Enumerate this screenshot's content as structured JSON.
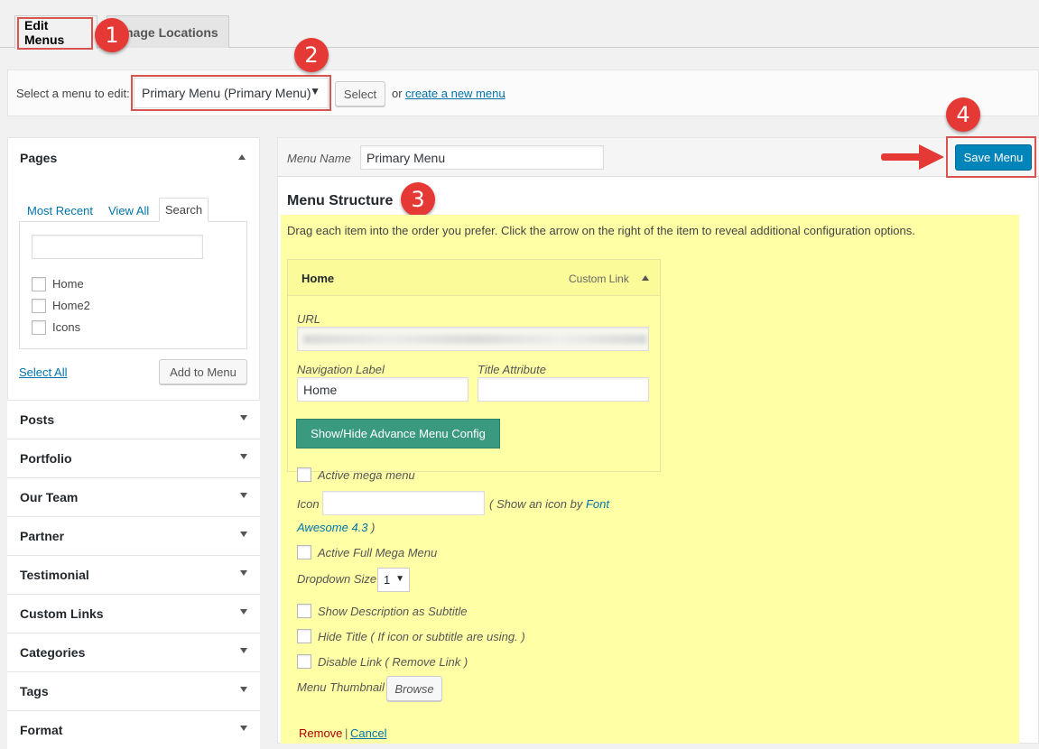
{
  "tabs": {
    "edit_menus": "Edit Menus",
    "manage_locations": "nage Locations"
  },
  "markers": {
    "m1": "1",
    "m2": "2",
    "m3": "3",
    "m4": "4"
  },
  "select_bar": {
    "label": "Select a menu to edit:",
    "selected_menu": "Primary Menu (Primary Menu)",
    "select_button": "Select",
    "or_text": "or",
    "create_link": "create a new menu",
    "period": "."
  },
  "left": {
    "pages_title": "Pages",
    "tabs": [
      "Most Recent",
      "View All",
      "Search"
    ],
    "pages": [
      "Home",
      "Home2",
      "Icons"
    ],
    "select_all": "Select All",
    "add_to_menu": "Add to Menu",
    "sections": [
      "Posts",
      "Portfolio",
      "Our Team",
      "Partner",
      "Testimonial",
      "Custom Links",
      "Categories",
      "Tags",
      "Format"
    ]
  },
  "menu": {
    "name_label": "Menu Name",
    "name_value": "Primary Menu",
    "save_button": "Save Menu",
    "structure_title": "Menu Structure",
    "instructions": "Drag each item into the order you prefer. Click the arrow on the right of the item to reveal additional configuration options.",
    "item": {
      "title": "Home",
      "type": "Custom Link",
      "url_label": "URL",
      "nav_label": "Navigation Label",
      "nav_value": "Home",
      "title_attr_label": "Title Attribute",
      "advance_button": "Show/Hide Advance Menu Config"
    },
    "options": {
      "active_mega": "Active mega menu",
      "icon_label": "Icon",
      "icon_hint_a": "( Show an icon by ",
      "icon_hint_link": "Font",
      "icon_hint_link2": "Awesome 4.3",
      "icon_hint_b": " )",
      "full_mega": "Active Full Mega Menu",
      "dropdown_label": "Dropdown Size",
      "dropdown_value": "1",
      "show_desc": "Show Description as Subtitle",
      "hide_title": "Hide Title ( If icon or subtitle are using. )",
      "disable_link": "Disable Link ( Remove Link )",
      "thumb_label": "Menu Thumbnail",
      "browse": "Browse"
    },
    "remove": "Remove",
    "separator": "|",
    "cancel": "Cancel"
  },
  "colors": {
    "marker": "#e53935",
    "primary_button": "#0085ba",
    "advance_button": "#3a9a7f",
    "highlight": "#ffffa6"
  }
}
